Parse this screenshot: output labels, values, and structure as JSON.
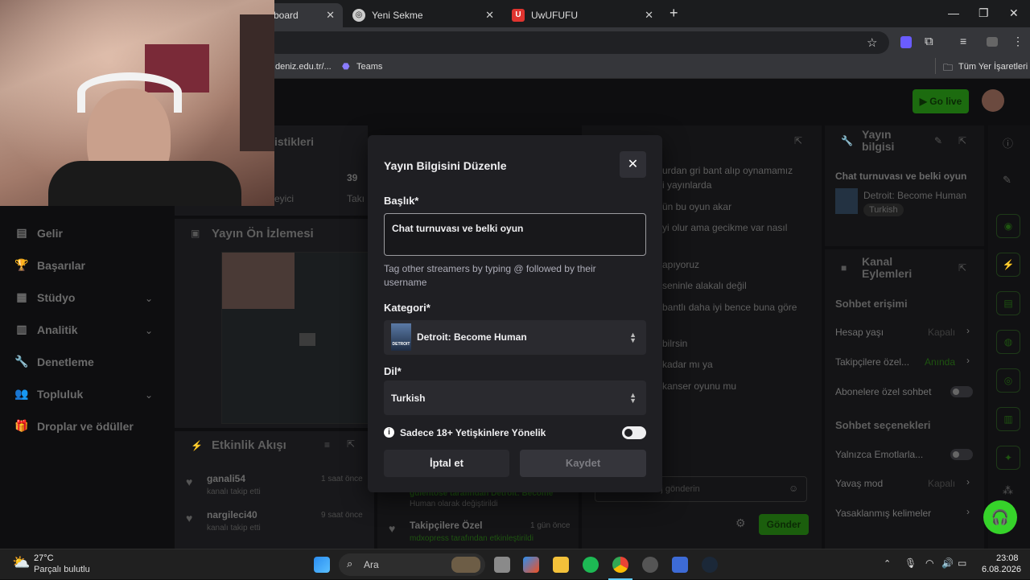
{
  "browser": {
    "tabs": [
      {
        "label": "board",
        "active": true
      },
      {
        "label": "Yeni Sekme",
        "active": false
      },
      {
        "label": "UwUFUFU",
        "active": false
      }
    ],
    "bookmarks": [
      {
        "label": "deniz.edu.tr/..."
      },
      {
        "label": "Teams"
      }
    ],
    "all_bookmarks": "Tüm Yer İşaretleri"
  },
  "header": {
    "go_live": "Go live"
  },
  "sidebar": {
    "items": [
      {
        "label": "Gelir"
      },
      {
        "label": "Başarılar"
      },
      {
        "label": "Stüdyo"
      },
      {
        "label": "Analitik"
      },
      {
        "label": "Denetleme"
      },
      {
        "label": "Topluluk"
      },
      {
        "label": "Droplar ve ödüller"
      }
    ]
  },
  "stats": {
    "title": "istikleri",
    "count": "39",
    "label1": "eyici",
    "label2": "Takı"
  },
  "preview": {
    "title": "Yayın Ön İzlemesi"
  },
  "activity": {
    "title": "Etkinlik Akışı",
    "items": [
      {
        "user": "ganali54",
        "action": "kanalı takip etti",
        "time": "1 saat önce"
      },
      {
        "user": "nargileci40",
        "action": "kanalı takip etti",
        "time": "9 saat önce"
      }
    ]
  },
  "mid_feed": {
    "line1": "gulentose tarafından Detroit: Become",
    "line2": "Human olarak değiştirildi",
    "followers_only": "Takipçilere Özel",
    "followers_time": "1 gün önce",
    "followers_sub": "mdxopress tarafından etkinleştirildi"
  },
  "chat": {
    "messages": [
      "urdan gri bant alıp oynamamız",
      "i yayınlarda",
      "ün bu oyun akar",
      "yi olur ama gecikme var nasıl",
      "apıyoruz",
      "seninle alakalı değil",
      "bantlı daha iyi bence buna göre",
      "bilrsin",
      "kadar mı ya",
      "kanser oyunu mu"
    ],
    "input_placeholder": "Bir mesaj gönderin",
    "send": "Gönder"
  },
  "stream_info": {
    "title": "Yayın bilgisi",
    "stream_title": "Chat turnuvası ve belki oyun",
    "category": "Detroit: Become Human",
    "language": "Turkish"
  },
  "channel_actions": {
    "title": "Kanal Eylemleri",
    "chat_access": "Sohbet erişimi",
    "account_age": "Hesap yaşı",
    "account_age_val": "Kapalı",
    "followers_only": "Takipçilere özel...",
    "followers_only_val": "Anında",
    "subs_only": "Abonelere özel sohbet",
    "chat_options": "Sohbet seçenekleri",
    "emote_only": "Yalnızca Emotlarla...",
    "slow_mode": "Yavaş mod",
    "slow_mode_val": "Kapalı",
    "banned_words": "Yasaklanmış kelimeler"
  },
  "modal": {
    "title": "Yayın Bilgisini Düzenle",
    "title_label": "Başlık*",
    "title_value": "Chat turnuvası ve belki oyun",
    "tag_hint": "Tag other streamers by typing @ followed by their username",
    "category_label": "Kategori*",
    "category_value": "Detroit: Become Human",
    "category_thumb": "DETROIT",
    "language_label": "Dil*",
    "language_value": "Turkish",
    "mature_label": "Sadece 18+ Yetişkinlere Yönelik",
    "mature_on": false,
    "cancel": "İptal et",
    "save": "Kaydet"
  },
  "taskbar": {
    "temp": "27°C",
    "weather": "Parçalı bulutlu",
    "search": "Ara",
    "time": "23:08",
    "date": "6.08.2026"
  },
  "colors": {
    "accent": "#53fc18",
    "modal_bg": "#1f1f23",
    "page_bg": "#0e0e10"
  }
}
